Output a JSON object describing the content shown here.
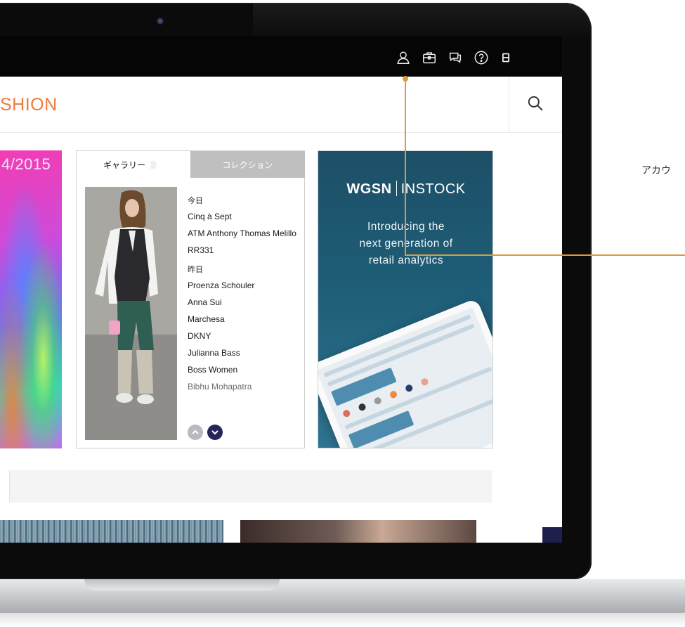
{
  "top_icons": [
    "account-icon",
    "briefcase-icon",
    "chat-icon",
    "help-icon",
    "menu-icon"
  ],
  "brand": {
    "text": "SHION",
    "color": "#f07a3a"
  },
  "hero": {
    "text": "4/2015"
  },
  "gallery": {
    "tab_gallery": "ギャラリー",
    "tab_gallery_chevrons": "》》",
    "tab_collection": "コレクション",
    "today_label": "今日",
    "today_items": [
      "Cinq à Sept",
      "ATM Anthony Thomas Melillo",
      "RR331"
    ],
    "yesterday_label": "昨日",
    "yesterday_items": [
      "Proenza Schouler",
      "Anna Sui",
      "Marchesa",
      "DKNY",
      "Julianna Bass",
      "Boss Women",
      "Bibhu Mohapatra"
    ]
  },
  "ad": {
    "logo_bold": "WGSN",
    "logo_light": "INSTOCK",
    "copy_lines": [
      "Introducing the",
      "next generation of",
      "retail analytics"
    ]
  },
  "callout": {
    "label": "アカウ"
  },
  "colors": {
    "accent": "#f07a3a",
    "callout": "#d99b3c",
    "ad_bg": "#1e5d77",
    "nav_dark": "#24265a"
  }
}
